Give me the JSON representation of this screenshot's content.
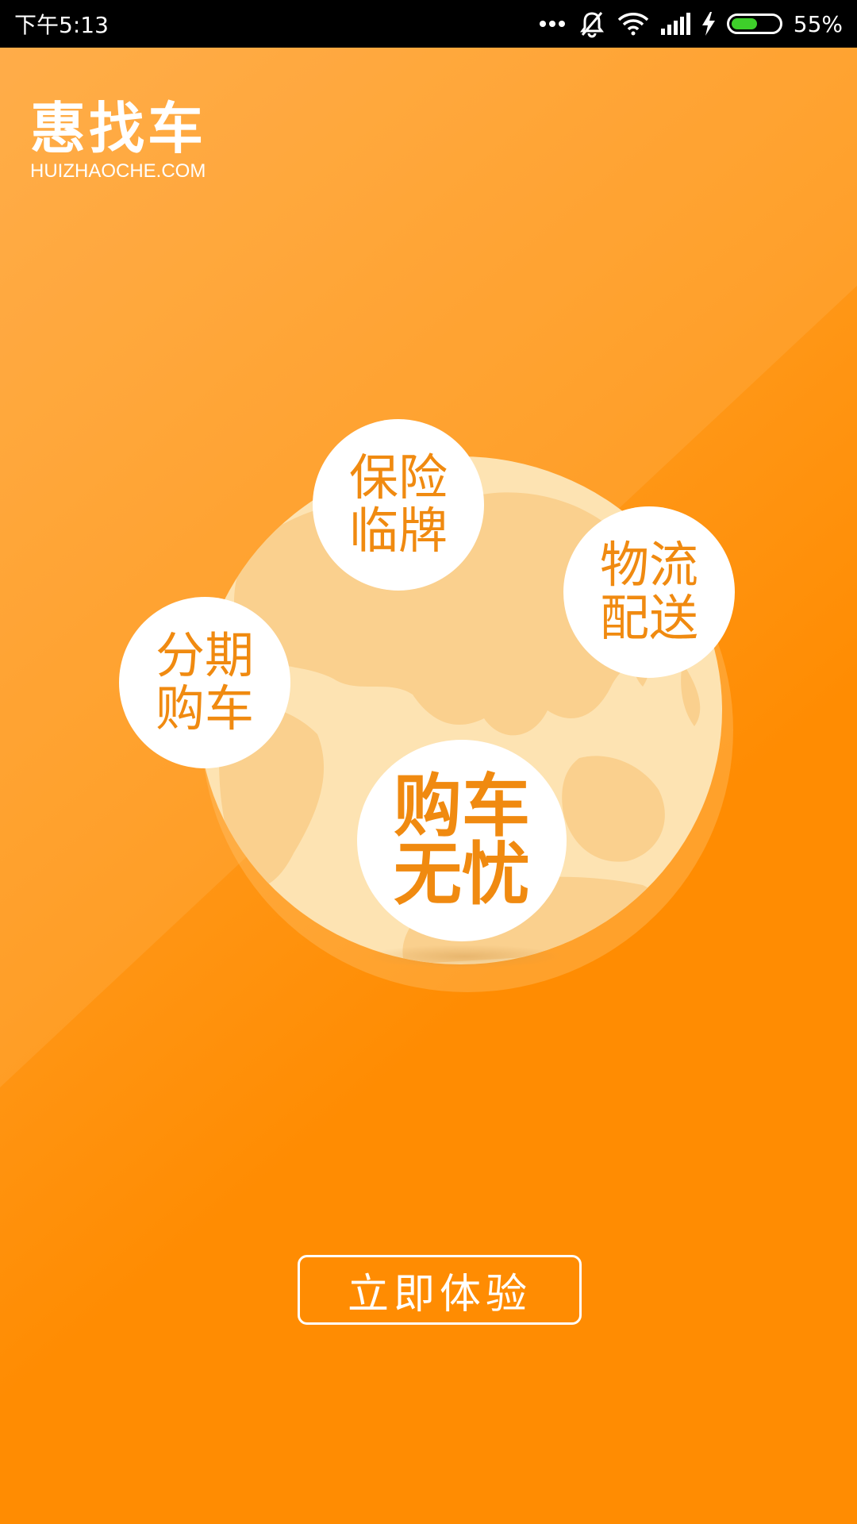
{
  "status_bar": {
    "time": "下午5:13",
    "battery_percent": "55%",
    "battery_level": 0.55,
    "icons": [
      "more-dots-icon",
      "mute-bell-icon",
      "wifi-icon",
      "signal-icon",
      "charging-icon",
      "battery-icon"
    ]
  },
  "logo": {
    "title": "惠找车",
    "subtitle": "HUIZHAOCHE.COM"
  },
  "features": {
    "insurance": "保险\n临牌",
    "logistics": "物流\n配送",
    "installment": "分期\n购车",
    "main": "购车\n无忧"
  },
  "cta": {
    "label": "立即体验"
  },
  "colors": {
    "background": "#FF8C00",
    "accent_text": "#F08A10",
    "globe": "#FDE3B2",
    "land": "#FAD08E",
    "white": "#FFFFFF"
  }
}
